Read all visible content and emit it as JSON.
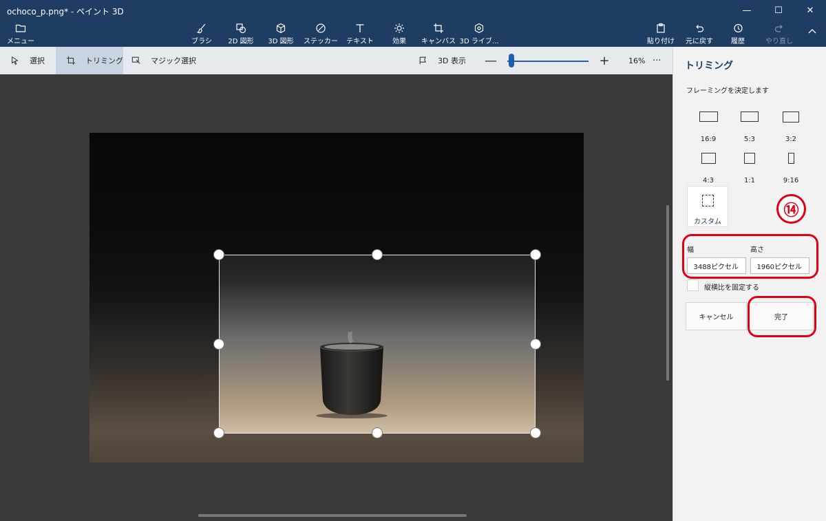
{
  "window": {
    "title": "ochoco_p.png* - ペイント 3D",
    "minimize": "—",
    "maximize": "☐",
    "close": "✕"
  },
  "ribbon": {
    "menu": "メニュー",
    "tools": [
      {
        "label": "ブラシ",
        "icon": "brush-icon"
      },
      {
        "label": "2D 図形",
        "icon": "2d-shapes-icon"
      },
      {
        "label": "3D 図形",
        "icon": "3d-shapes-icon"
      },
      {
        "label": "ステッカー",
        "icon": "sticker-icon"
      },
      {
        "label": "テキスト",
        "icon": "text-icon"
      },
      {
        "label": "効果",
        "icon": "effects-icon"
      },
      {
        "label": "キャンバス",
        "icon": "canvas-icon"
      },
      {
        "label": "3D ライブ...",
        "icon": "3d-library-icon"
      }
    ],
    "paste": "貼り付け",
    "undo": "元に戻す",
    "history": "履歴",
    "redo": "やり直し"
  },
  "toolbar": {
    "select": "選択",
    "crop": "トリミング",
    "magic_select": "マジック選択",
    "view3d": "3D 表示",
    "zoom_minus": "—",
    "zoom_plus": "+",
    "zoom_level": "16%",
    "more": "···"
  },
  "panel": {
    "title": "トリミング",
    "subtitle": "フレーミングを決定します",
    "ratios": [
      "16:9",
      "5:3",
      "3:2",
      "4:3",
      "1:1",
      "9:16"
    ],
    "custom": "カスタム",
    "annotation": "⑭",
    "width_label": "幅",
    "height_label": "高さ",
    "width_value": "3488ピクセル",
    "height_value": "1960ピクセル",
    "lock_aspect": "縦横比を固定する",
    "cancel": "キャンセル",
    "done": "完了"
  }
}
